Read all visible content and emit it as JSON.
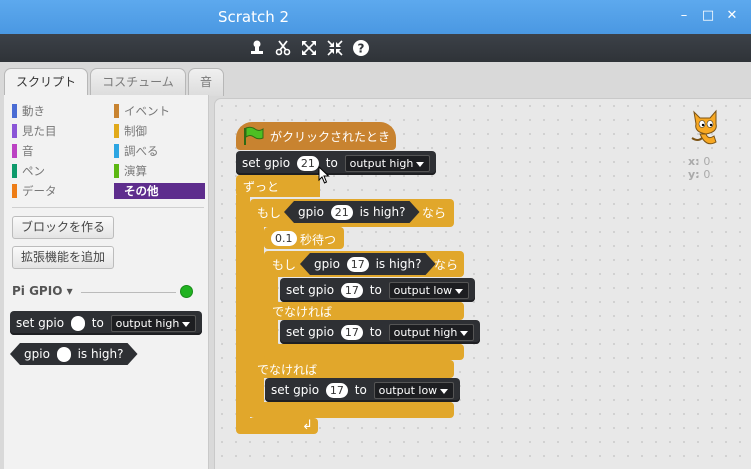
{
  "window": {
    "title": "Scratch 2"
  },
  "tabs": [
    "スクリプト",
    "コスチューム",
    "音"
  ],
  "categories": {
    "left": [
      "動き",
      "見た目",
      "音",
      "ペン",
      "データ"
    ],
    "right": [
      "イベント",
      "制御",
      "調べる",
      "演算",
      "その他"
    ]
  },
  "colors": {
    "motion": "#4a6cd4",
    "looks": "#8a55d7",
    "sound": "#bb42c3",
    "pen": "#0e9a6c",
    "data": "#ee7d16",
    "events": "#c88330",
    "control": "#e1a91a",
    "sensing": "#2ca5e2",
    "operators": "#5cb712",
    "more": "#5e2d8d"
  },
  "palette": {
    "make_block": "ブロックを作る",
    "add_extension": "拡張機能を追加",
    "extension_name": "Pi GPIO ▾",
    "pal_set_gpio": {
      "set": "set gpio",
      "to": "to",
      "value": "output high"
    },
    "pal_gpio_high": {
      "pre": "gpio",
      "post": "is high?"
    }
  },
  "script": {
    "hat": "がクリックされたとき",
    "set1": {
      "set": "set gpio",
      "pin": "21",
      "to": "to",
      "value": "output high"
    },
    "forever": "ずっと",
    "if1": {
      "if": "もし",
      "cond_pre": "gpio",
      "pin": "21",
      "cond_post": "is high?",
      "then": "なら"
    },
    "wait": {
      "num": "0.1",
      "label": "秒待つ"
    },
    "if2": {
      "if": "もし",
      "cond_pre": "gpio",
      "pin": "17",
      "cond_post": "is high?",
      "then": "なら"
    },
    "set2": {
      "set": "set gpio",
      "pin": "17",
      "to": "to",
      "value": "output low"
    },
    "else1": "でなければ",
    "set3": {
      "set": "set gpio",
      "pin": "17",
      "to": "to",
      "value": "output high"
    },
    "else2": "でなければ",
    "set4": {
      "set": "set gpio",
      "pin": "17",
      "to": "to",
      "value": "output low"
    },
    "loop_arrow": "↲"
  },
  "stage": {
    "x_label": "x:",
    "x_value": "0",
    "y_label": "y:",
    "y_value": "0"
  }
}
